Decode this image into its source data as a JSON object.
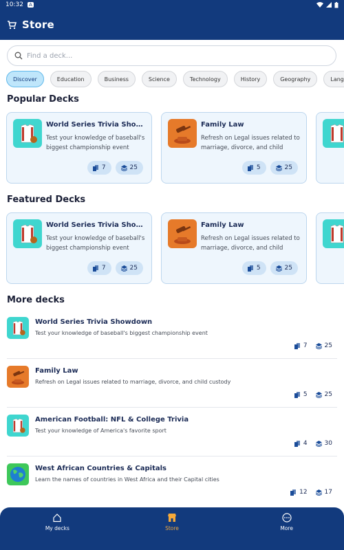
{
  "status": {
    "time": "10:32",
    "indicator": "A"
  },
  "app_bar": {
    "title": "Store",
    "icon": "cart-icon"
  },
  "search": {
    "placeholder": "Find a deck..."
  },
  "categories": [
    "Discover",
    "Education",
    "Business",
    "Science",
    "Technology",
    "History",
    "Geography",
    "Language"
  ],
  "active_category": "Discover",
  "popular": {
    "title": "Popular Decks",
    "cards": [
      {
        "title": "World Series Trivia Showdown",
        "desc": "Test your knowledge of baseball's biggest championship event",
        "count_a": "7",
        "count_b": "25",
        "thumb": "trivia"
      },
      {
        "title": "Family Law",
        "desc": "Refresh on Legal issues related to marriage, divorce, and child custody",
        "count_a": "5",
        "count_b": "25",
        "thumb": "law"
      }
    ]
  },
  "featured": {
    "title": "Featured Decks",
    "cards": [
      {
        "title": "World Series Trivia Showdown",
        "desc": "Test your knowledge of baseball's biggest championship event",
        "count_a": "7",
        "count_b": "25",
        "thumb": "trivia"
      },
      {
        "title": "Family Law",
        "desc": "Refresh on Legal issues related to marriage, divorce, and child custody",
        "count_a": "5",
        "count_b": "25",
        "thumb": "law"
      }
    ]
  },
  "more": {
    "title": "More decks",
    "items": [
      {
        "title": "World Series Trivia Showdown",
        "desc": "Test your knowledge of baseball's biggest championship event",
        "count_a": "7",
        "count_b": "25",
        "thumb": "trivia"
      },
      {
        "title": "Family Law",
        "desc": "Refresh on Legal issues related to marriage, divorce, and child custody",
        "count_a": "5",
        "count_b": "25",
        "thumb": "law"
      },
      {
        "title": "American Football: NFL & College Trivia",
        "desc": "Test your knowledge of America's favorite sport",
        "count_a": "4",
        "count_b": "30",
        "thumb": "trivia"
      },
      {
        "title": "West African Countries & Capitals",
        "desc": "Learn the names of countries in West Africa and their Capital cities",
        "count_a": "12",
        "count_b": "17",
        "thumb": "geo"
      }
    ]
  },
  "bottom_nav": [
    {
      "label": "My decks",
      "icon": "home-icon",
      "active": false
    },
    {
      "label": "Store",
      "icon": "store-icon",
      "active": true
    },
    {
      "label": "More",
      "icon": "more-icon",
      "active": false
    }
  ],
  "colors": {
    "primary": "#123a7d",
    "accent": "#f5a93a",
    "chip_active": "#bfe6fb",
    "card_bg": "#eef6fd"
  }
}
